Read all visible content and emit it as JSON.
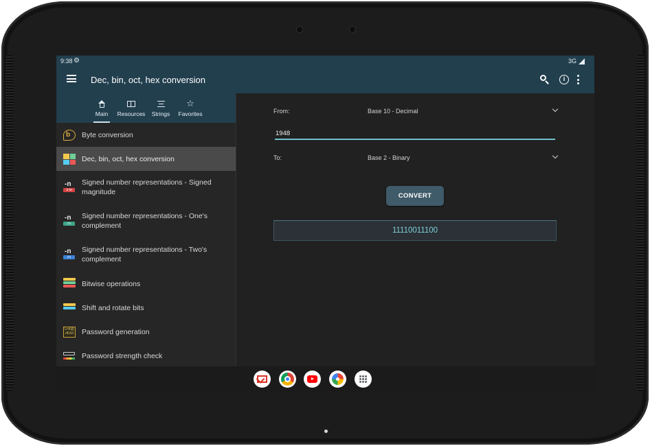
{
  "status_bar": {
    "time": "9:38",
    "network": "3G"
  },
  "app_bar": {
    "title": "Dec, bin, oct, hex conversion"
  },
  "tabs": [
    {
      "label": "Main",
      "icon": "home-icon",
      "active": true
    },
    {
      "label": "Resources",
      "icon": "book-icon",
      "active": false
    },
    {
      "label": "Strings",
      "icon": "text-lines-icon",
      "active": false
    },
    {
      "label": "Favorites",
      "icon": "star-icon",
      "active": false
    }
  ],
  "nav_items": [
    {
      "label": "Byte conversion",
      "icon": "byte-conversion-icon"
    },
    {
      "label": "Dec, bin, oct, hex conversion",
      "icon": "base-grid-icon",
      "selected": true
    },
    {
      "label": "Signed number representations - Signed magnitude",
      "icon": "signed-magnitude-icon",
      "badge": "S-M"
    },
    {
      "label": "Signed number representations - One's complement",
      "icon": "ones-complement-icon",
      "badge": "1's"
    },
    {
      "label": "Signed number representations - Two's complement",
      "icon": "twos-complement-icon",
      "badge": "2's"
    },
    {
      "label": "Bitwise operations",
      "icon": "bitwise-operations-icon"
    },
    {
      "label": "Shift and rotate bits",
      "icon": "shift-rotate-icon"
    },
    {
      "label": "Password generation",
      "icon": "password-generation-icon",
      "badge": "Ln4@ d5Xd"
    },
    {
      "label": "Password strength check",
      "icon": "password-strength-icon"
    }
  ],
  "converter": {
    "from_label": "From:",
    "from_value": "Base 10 - Decimal",
    "input_value": "1948",
    "to_label": "To:",
    "to_value": "Base 2 - Binary",
    "convert_label": "CONVERT",
    "result": "11110011100"
  },
  "dock_apps": [
    "gmail-icon",
    "chrome-icon",
    "youtube-icon",
    "photos-icon",
    "app-drawer-icon"
  ],
  "colors": {
    "app_bar": "#223f4e",
    "background": "#212121",
    "accent": "#6fc3cf",
    "selected_item": "#4a4a4a",
    "button": "#3f5a68"
  }
}
